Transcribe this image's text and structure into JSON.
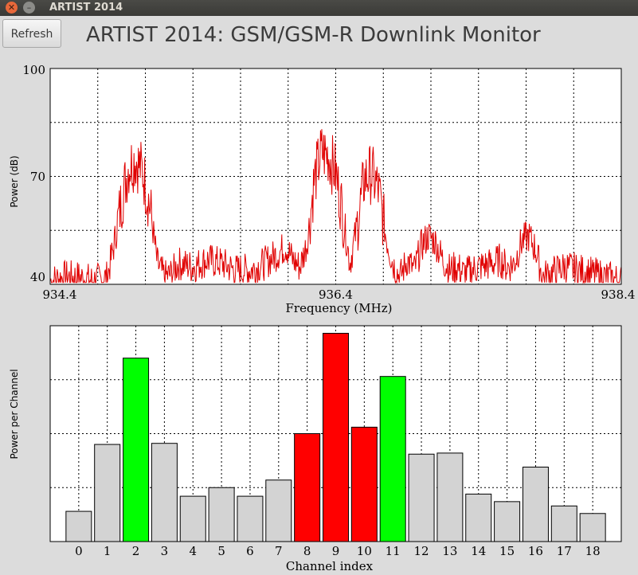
{
  "window": {
    "title": "ARTIST 2014",
    "close_glyph": "✕",
    "minimize_glyph": "–"
  },
  "toolbar": {
    "refresh_label": "Refresh"
  },
  "app_title": "ARTIST 2014: GSM/GSM-R Downlink Monitor",
  "chart_data": [
    {
      "type": "line",
      "title": "",
      "xlabel": "Frequency (MHz)",
      "ylabel": "Power (dB)",
      "xlim": [
        934.4,
        938.4
      ],
      "ylim": [
        38,
        100
      ],
      "x_tick_labels": [
        "934.4",
        "936.4",
        "938.4"
      ],
      "y_tick_labels": [
        "40",
        "70",
        "100"
      ],
      "grid": true,
      "series_color": "#e00000",
      "series": [
        {
          "x": [
            934.4,
            934.5,
            934.6,
            934.7,
            934.8,
            934.85,
            934.9,
            934.95,
            935.0,
            935.05,
            935.1,
            935.15,
            935.2,
            935.25,
            935.3,
            935.4,
            935.5,
            935.6,
            935.7,
            935.8,
            935.9,
            936.0,
            936.05,
            936.1,
            936.15,
            936.2,
            936.25,
            936.3,
            936.35,
            936.4,
            936.45,
            936.5,
            936.55,
            936.6,
            936.65,
            936.7,
            936.75,
            936.8,
            936.85,
            936.9,
            936.95,
            937.0,
            937.05,
            937.1,
            937.15,
            937.2,
            937.25,
            937.3,
            937.4,
            937.5,
            937.55,
            937.6,
            937.65,
            937.7,
            937.75,
            937.8,
            937.85,
            937.9,
            938.0,
            938.1,
            938.2,
            938.3,
            938.4
          ],
          "y": [
            39,
            40,
            40,
            39,
            40,
            50,
            62,
            72,
            74,
            70,
            60,
            44,
            40,
            41,
            44,
            43,
            45,
            44,
            42,
            42,
            44,
            47,
            49,
            45,
            43,
            50,
            68,
            76,
            75,
            70,
            58,
            44,
            55,
            68,
            70,
            65,
            52,
            44,
            40,
            45,
            42,
            49,
            52,
            50,
            45,
            42,
            43,
            41,
            43,
            44,
            45,
            43,
            44,
            50,
            52,
            48,
            40,
            41,
            43,
            42,
            41,
            40,
            39
          ]
        }
      ]
    },
    {
      "type": "bar",
      "title": "",
      "xlabel": "Channel index",
      "ylabel": "Power per Channel",
      "categories": [
        "0",
        "1",
        "2",
        "3",
        "4",
        "5",
        "6",
        "7",
        "8",
        "9",
        "10",
        "11",
        "12",
        "13",
        "14",
        "15",
        "16",
        "17",
        "18"
      ],
      "values": [
        0.14,
        0.45,
        0.85,
        0.455,
        0.21,
        0.25,
        0.21,
        0.285,
        0.5,
        0.965,
        0.53,
        0.765,
        0.405,
        0.41,
        0.22,
        0.185,
        0.345,
        0.165,
        0.13
      ],
      "ylim": [
        0,
        1
      ],
      "grid": true,
      "colors": {
        "default": "#d3d3d3",
        "green": "#00ff00",
        "red": "#ff0000",
        "edge": "#000000"
      },
      "bar_colors": [
        "default",
        "default",
        "green",
        "default",
        "default",
        "default",
        "default",
        "default",
        "red",
        "red",
        "red",
        "green",
        "default",
        "default",
        "default",
        "default",
        "default",
        "default",
        "default"
      ]
    }
  ]
}
